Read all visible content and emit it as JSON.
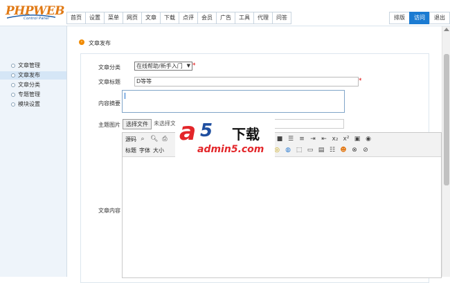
{
  "header": {
    "logo_text": "PHPWEB",
    "logo_sub": "Control Panel",
    "nav": [
      "首页",
      "设置",
      "菜单",
      "网页",
      "文章",
      "下载",
      "点评",
      "会员",
      "广告",
      "工具",
      "代理",
      "问答"
    ],
    "right_nav": [
      {
        "label": "排版",
        "active": false
      },
      {
        "label": "访问",
        "active": true
      },
      {
        "label": "退出",
        "active": false
      }
    ]
  },
  "sidebar": {
    "items": [
      {
        "label": "文章管理",
        "active": false
      },
      {
        "label": "文章发布",
        "active": true
      },
      {
        "label": "文章分类",
        "active": false
      },
      {
        "label": "专题管理",
        "active": false
      },
      {
        "label": "模块设置",
        "active": false
      }
    ]
  },
  "main": {
    "breadcrumb": "文章发布",
    "form": {
      "category_label": "文章分类",
      "category_value": "在线帮助/新手入门",
      "title_label": "文章标题",
      "title_value": "D等等",
      "summary_label": "内容摘要",
      "image_label": "主题图片",
      "file_button": "选择文件",
      "file_status": "未选择文件",
      "content_label": "文章内容",
      "required_mark": "*"
    },
    "editor": {
      "row1_text": "源码",
      "row2_labels": [
        "标题",
        "字体",
        "大小"
      ]
    }
  },
  "watermark": {
    "brand_a": "a",
    "brand_5": "5",
    "brand_download": "下载",
    "domain": "admin5.com"
  },
  "colors": {
    "accent": "#1b7bd2",
    "logo_orange": "#e07a16",
    "required": "#dd0000",
    "sidebar_bg": "#eef4fa"
  }
}
